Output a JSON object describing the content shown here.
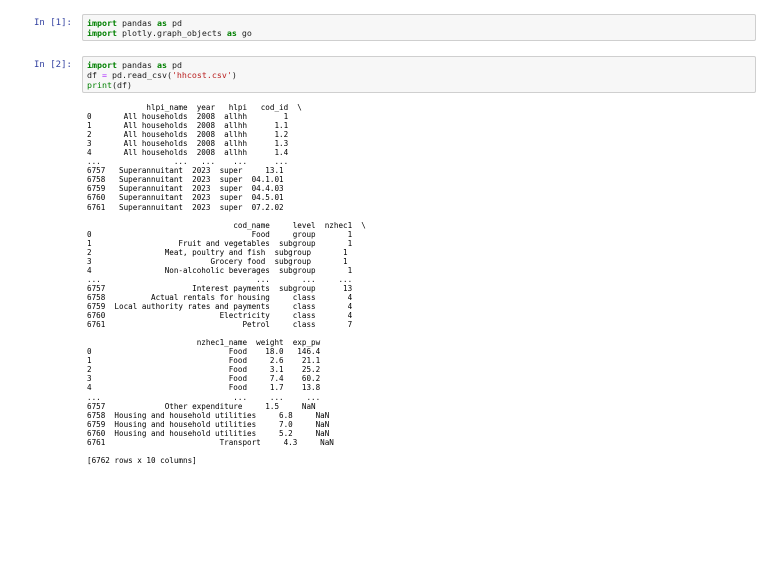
{
  "cells": [
    {
      "prompt": "In [1]:",
      "code": [
        [
          {
            "t": "import",
            "c": "kw"
          },
          {
            "t": " pandas ",
            "c": ""
          },
          {
            "t": "as",
            "c": "kw"
          },
          {
            "t": " pd",
            "c": ""
          }
        ],
        [
          {
            "t": "import",
            "c": "kw"
          },
          {
            "t": " plotly.graph_objects ",
            "c": ""
          },
          {
            "t": "as",
            "c": "kw"
          },
          {
            "t": " go",
            "c": ""
          }
        ]
      ]
    },
    {
      "prompt": "In [2]:",
      "code": [
        [
          {
            "t": "import",
            "c": "kw"
          },
          {
            "t": " pandas ",
            "c": ""
          },
          {
            "t": "as",
            "c": "kw"
          },
          {
            "t": " pd",
            "c": ""
          }
        ],
        [
          {
            "t": "df ",
            "c": ""
          },
          {
            "t": "=",
            "c": "op"
          },
          {
            "t": " pd.read_csv(",
            "c": ""
          },
          {
            "t": "'hhcost.csv'",
            "c": "str"
          },
          {
            "t": ")",
            "c": ""
          }
        ],
        [
          {
            "t": "print",
            "c": "kw2"
          },
          {
            "t": "(df)",
            "c": ""
          }
        ]
      ],
      "output": [
        "             hlpi_name  year   hlpi   cod_id  \\",
        "0       All households  2008  allhh        1",
        "1       All households  2008  allhh      1.1",
        "2       All households  2008  allhh      1.2",
        "3       All households  2008  allhh      1.3",
        "4       All households  2008  allhh      1.4",
        "...                ...   ...    ...      ...",
        "6757   Superannuitant  2023  super     13.1",
        "6758   Superannuitant  2023  super  04.1.01",
        "6759   Superannuitant  2023  super  04.4.03",
        "6760   Superannuitant  2023  super  04.5.01",
        "6761   Superannuitant  2023  super  07.2.02",
        "",
        "                                cod_name     level  nzhec1  \\",
        "0                                   Food     group       1",
        "1                   Fruit and vegetables  subgroup       1",
        "2                Meat, poultry and fish  subgroup       1",
        "3                          Grocery food  subgroup       1",
        "4                Non-alcoholic beverages  subgroup       1",
        "...                                  ...       ...     ...",
        "6757                   Interest payments  subgroup      13",
        "6758          Actual rentals for housing     class       4",
        "6759  Local authority rates and payments     class       4",
        "6760                         Electricity     class       4",
        "6761                              Petrol     class       7",
        "",
        "                        nzhec1_name  weight  exp_pw",
        "0                              Food    18.0   146.4",
        "1                              Food     2.6    21.1",
        "2                              Food     3.1    25.2",
        "3                              Food     7.4    60.2",
        "4                              Food     1.7    13.8",
        "...                             ...     ...     ...",
        "6757             Other expenditure     1.5     NaN",
        "6758  Housing and household utilities     6.8     NaN",
        "6759  Housing and household utilities     7.0     NaN",
        "6760  Housing and household utilities     5.2     NaN",
        "6761                         Transport     4.3     NaN",
        "",
        "[6762 rows x 10 columns]"
      ]
    }
  ],
  "colors": {
    "prompt": "#303f9f",
    "keyword": "#008000",
    "operator": "#aa22ff",
    "string": "#ba2121",
    "input_bg": "#f7f7f7",
    "input_border": "#cfcfcf"
  }
}
